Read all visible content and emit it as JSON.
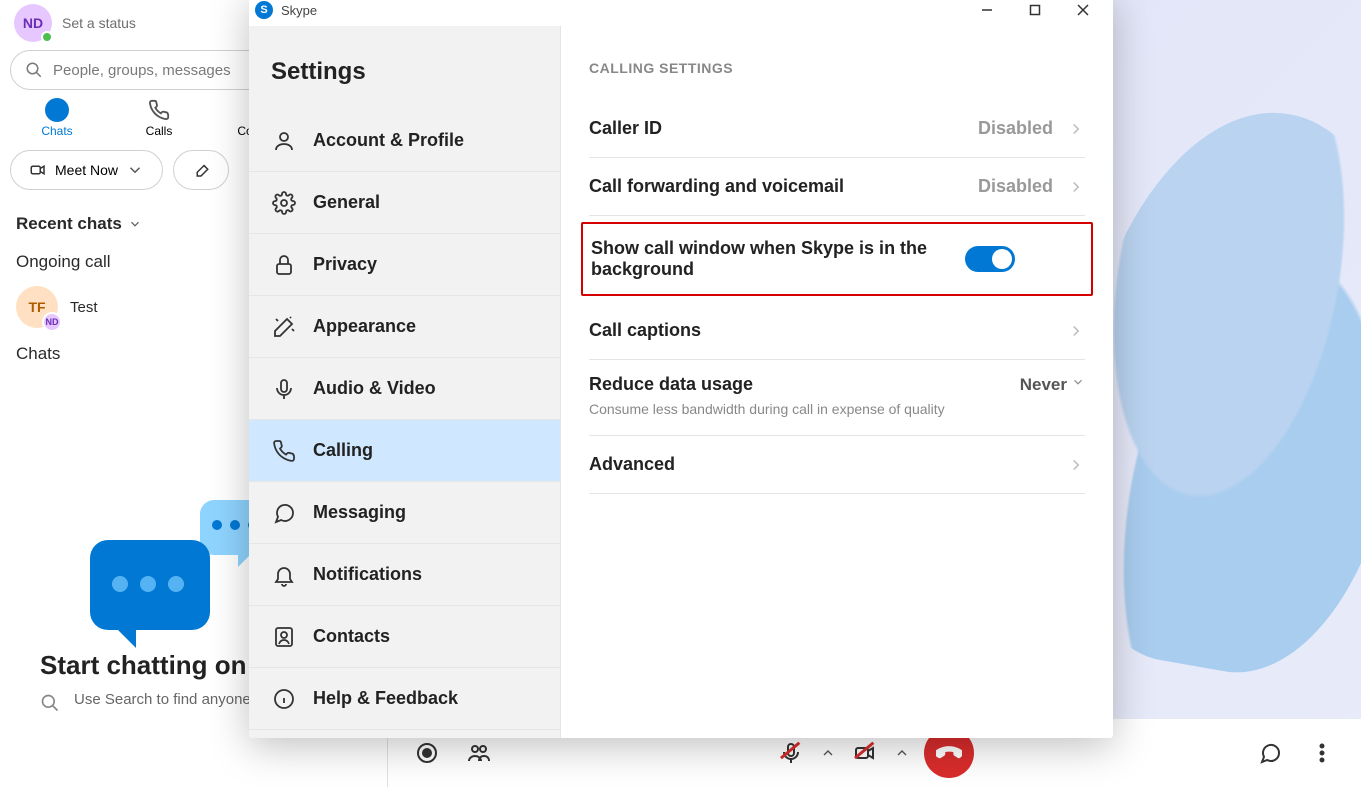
{
  "profile": {
    "initials": "ND",
    "status_prompt": "Set a status"
  },
  "search": {
    "placeholder": "People, groups, messages"
  },
  "nav": {
    "chats": "Chats",
    "calls": "Calls",
    "contacts": "Contacts"
  },
  "buttons": {
    "meet_now": "Meet Now"
  },
  "sections": {
    "recent": "Recent chats",
    "ongoing": "Ongoing call",
    "chats": "Chats"
  },
  "chat_item": {
    "avatar": "TF",
    "mini": "ND",
    "name": "Test"
  },
  "empty": {
    "title": "Start chatting on Skype",
    "sub": "Use Search to find anyone on Skype."
  },
  "titlebar": {
    "app": "Skype"
  },
  "settings": {
    "title": "Settings",
    "items": [
      "Account & Profile",
      "General",
      "Privacy",
      "Appearance",
      "Audio & Video",
      "Calling",
      "Messaging",
      "Notifications",
      "Contacts",
      "Help & Feedback"
    ]
  },
  "calling": {
    "header": "CALLING SETTINGS",
    "caller_id": {
      "label": "Caller ID",
      "value": "Disabled"
    },
    "forwarding": {
      "label": "Call forwarding and voicemail",
      "value": "Disabled"
    },
    "show_window": {
      "label": "Show call window when Skype is in the background"
    },
    "captions": {
      "label": "Call captions"
    },
    "reduce": {
      "label": "Reduce data usage",
      "value": "Never",
      "sub": "Consume less bandwidth during call in expense of quality"
    },
    "advanced": {
      "label": "Advanced"
    }
  }
}
